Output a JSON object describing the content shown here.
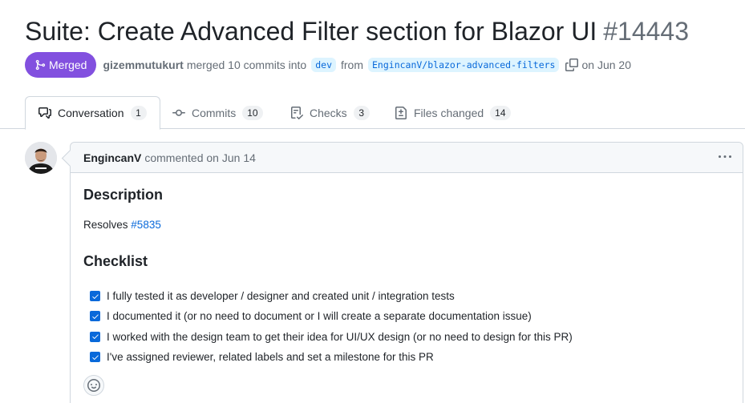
{
  "pr": {
    "title": "Suite: Create Advanced Filter section for Blazor UI",
    "number": "#14443",
    "state": "Merged",
    "author": "gizemmutukurt",
    "action": "merged 10 commits into",
    "base_branch": "dev",
    "from_word": "from",
    "head_branch": "EngincanV/blazor-advanced-filters",
    "date": "on Jun 20"
  },
  "tabs": [
    {
      "label": "Conversation",
      "count": "1",
      "icon": "comment-discussion-icon"
    },
    {
      "label": "Commits",
      "count": "10",
      "icon": "git-commit-icon"
    },
    {
      "label": "Checks",
      "count": "3",
      "icon": "checklist-icon"
    },
    {
      "label": "Files changed",
      "count": "14",
      "icon": "file-diff-icon"
    }
  ],
  "comment": {
    "author": "EngincanV",
    "meta": "commented on Jun 14",
    "description_heading": "Description",
    "resolves_text": "Resolves",
    "resolves_link": "#5835",
    "checklist_heading": "Checklist",
    "checklist": [
      "I fully tested it as developer / designer and created unit / integration tests",
      "I documented it (or no need to document or I will create a separate documentation issue)",
      "I worked with the design team to get their idea for UI/UX design (or no need to design for this PR)",
      "I've assigned reviewer, related labels and set a milestone for this PR"
    ]
  },
  "colors": {
    "merged": "#8250df",
    "link": "#0969da",
    "checkbox": "#0969da"
  }
}
